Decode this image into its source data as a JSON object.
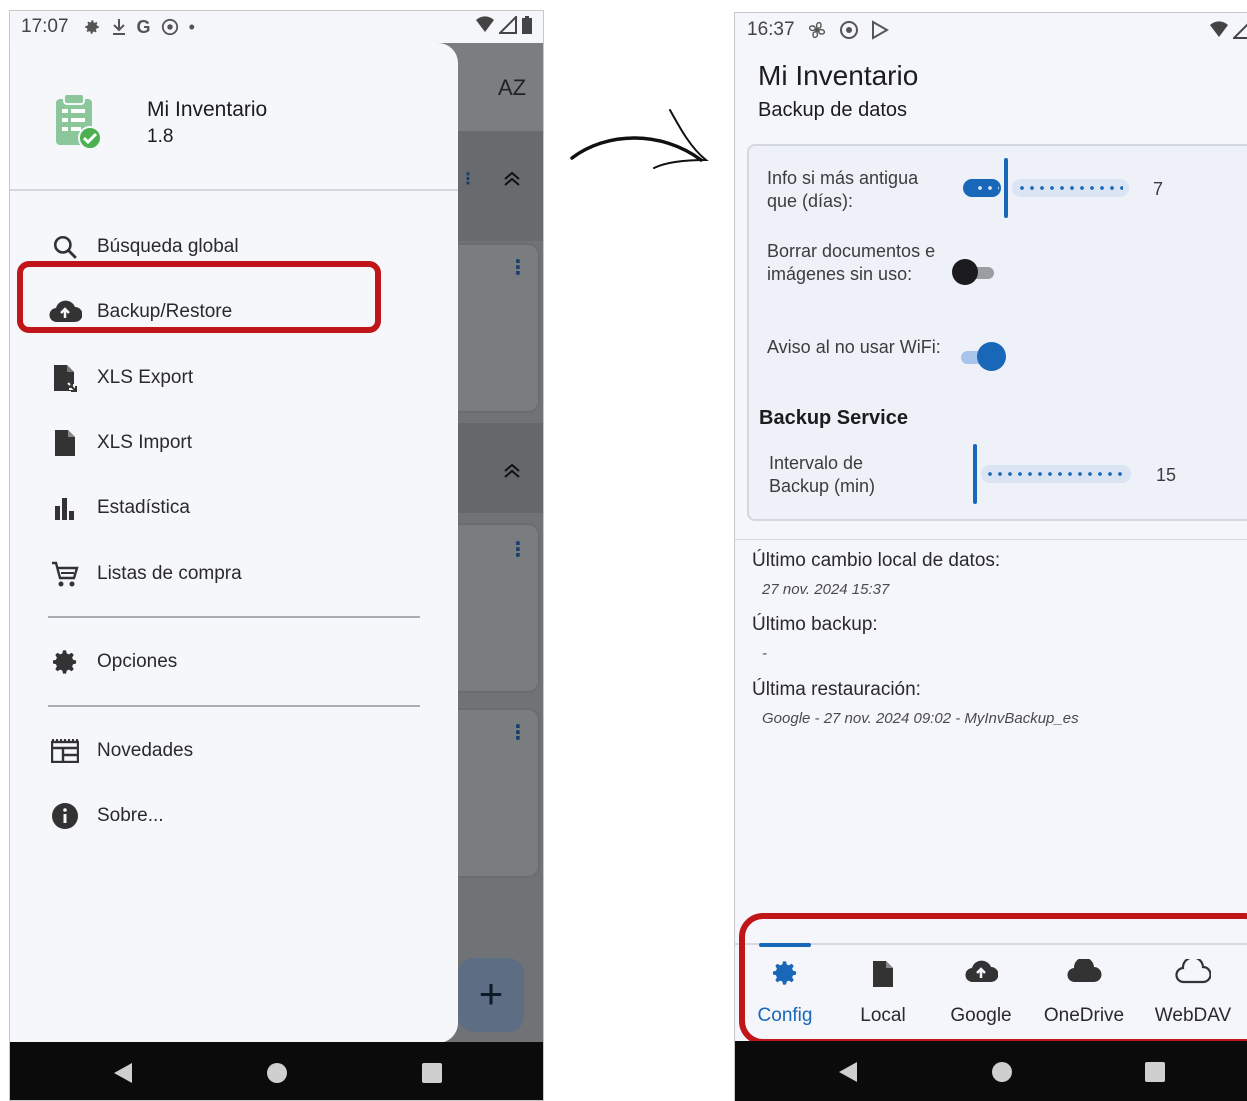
{
  "left_phone": {
    "status_time": "17:07",
    "drawer": {
      "app_name": "Mi Inventario",
      "app_version": "1.8",
      "items": [
        {
          "label": "Búsqueda global",
          "icon": "search-icon"
        },
        {
          "label": "Backup/Restore",
          "icon": "cloud-upload-icon"
        },
        {
          "label": "XLS Export",
          "icon": "file-export-icon"
        },
        {
          "label": "XLS Import",
          "icon": "file-icon"
        },
        {
          "label": "Estadística",
          "icon": "bar-chart-icon"
        },
        {
          "label": "Listas de compra",
          "icon": "shopping-cart-icon"
        },
        {
          "label": "Opciones",
          "icon": "gear-icon"
        },
        {
          "label": "Novedades",
          "icon": "news-icon"
        },
        {
          "label": "Sobre...",
          "icon": "info-icon"
        }
      ]
    },
    "background_sort_label": "AZ",
    "highlight_color": "#c0161a"
  },
  "right_phone": {
    "status_time": "16:37",
    "title": "Mi Inventario",
    "subtitle": "Backup de datos",
    "settings": {
      "info_older_label": "Info si más antigua que (días):",
      "info_older_value": "7",
      "delete_unused_label": "Borrar documentos e imágenes sin uso:",
      "delete_unused_on": false,
      "wifi_warning_label": "Aviso al no usar WiFi:",
      "wifi_warning_on": true,
      "section_title": "Backup Service",
      "interval_label": "Intervalo de Backup (min)",
      "interval_value": "15"
    },
    "info": {
      "last_local_change_label": "Último cambio local de datos:",
      "last_local_change_value": "27 nov. 2024 15:37",
      "last_backup_label": "Último backup:",
      "last_backup_value": "-",
      "last_restore_label": "Última restauración:",
      "last_restore_value": "Google - 27 nov. 2024 09:02 - MyInvBackup_es"
    },
    "tabs": [
      {
        "label": "Config",
        "icon": "gear-icon",
        "active": true
      },
      {
        "label": "Local",
        "icon": "file-icon",
        "active": false
      },
      {
        "label": "Google",
        "icon": "cloud-upload-icon",
        "active": false
      },
      {
        "label": "OneDrive",
        "icon": "cloud-filled-icon",
        "active": false
      },
      {
        "label": "WebDAV",
        "icon": "cloud-outline-icon",
        "active": false
      }
    ],
    "accent_color": "#1867b8"
  }
}
